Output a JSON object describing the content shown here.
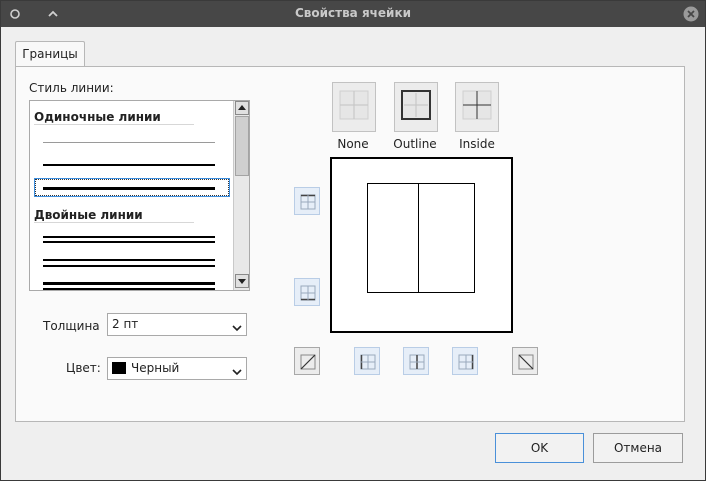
{
  "window": {
    "title": "Свойства ячейки"
  },
  "tabs": [
    {
      "label": "Границы"
    }
  ],
  "line_style": {
    "label": "Стиль линии:",
    "groups": [
      {
        "heading": "Одиночные линии"
      },
      {
        "heading": "Двойные линии"
      }
    ]
  },
  "thickness": {
    "label": "Толщина",
    "value": "2 пт"
  },
  "color": {
    "label": "Цвет:",
    "value": "Черный",
    "swatch": "#000000"
  },
  "presets": [
    {
      "label": "None"
    },
    {
      "label": "Outline"
    },
    {
      "label": "Inside"
    }
  ],
  "icons": {
    "close": "close-icon",
    "menu": "window-menu-icon",
    "collapse": "chevron-up-icon",
    "combo_arrow": "chevron-down-icon"
  },
  "buttons": {
    "ok": "OK",
    "cancel": "Отмена"
  },
  "accent": "#4a90d9"
}
